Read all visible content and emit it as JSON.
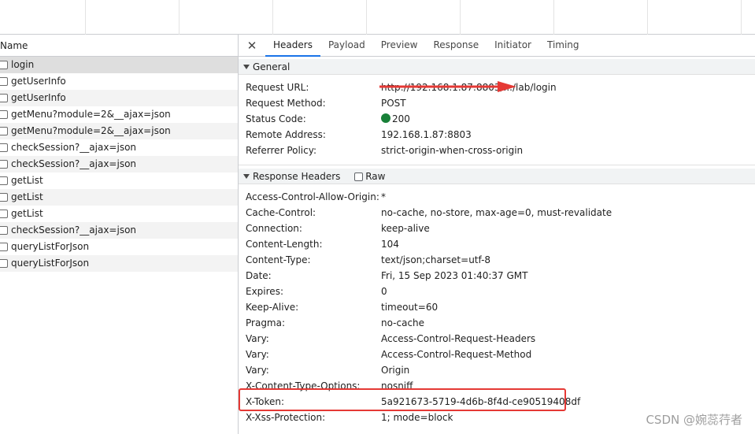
{
  "list": {
    "column_name": "Name",
    "requests": [
      "login",
      "getUserInfo",
      "getUserInfo",
      "getMenu?module=2&__ajax=json",
      "getMenu?module=2&__ajax=json",
      "checkSession?__ajax=json",
      "checkSession?__ajax=json",
      "getList",
      "getList",
      "getList",
      "checkSession?__ajax=json",
      "queryListForJson",
      "queryListForJson"
    ]
  },
  "tabs": {
    "close": "✕",
    "headers": "Headers",
    "payload": "Payload",
    "preview": "Preview",
    "response": "Response",
    "initiator": "Initiator",
    "timing": "Timing"
  },
  "general": {
    "title": "General",
    "request_url_label": "Request URL:",
    "request_url_value": "http://192.168.1.87:8803/.../lab/login",
    "request_method_label": "Request Method:",
    "request_method_value": "POST",
    "status_code_label": "Status Code:",
    "status_code_value": "200",
    "remote_address_label": "Remote Address:",
    "remote_address_value": "192.168.1.87:8803",
    "referrer_policy_label": "Referrer Policy:",
    "referrer_policy_value": "strict-origin-when-cross-origin"
  },
  "response_headers": {
    "title": "Response Headers",
    "raw_label": "Raw",
    "rows": [
      {
        "k": "Access-Control-Allow-Origin:",
        "v": "*"
      },
      {
        "k": "Cache-Control:",
        "v": "no-cache, no-store, max-age=0, must-revalidate"
      },
      {
        "k": "Connection:",
        "v": "keep-alive"
      },
      {
        "k": "Content-Length:",
        "v": "104"
      },
      {
        "k": "Content-Type:",
        "v": "text/json;charset=utf-8"
      },
      {
        "k": "Date:",
        "v": "Fri, 15 Sep 2023 01:40:37 GMT"
      },
      {
        "k": "Expires:",
        "v": "0"
      },
      {
        "k": "Keep-Alive:",
        "v": "timeout=60"
      },
      {
        "k": "Pragma:",
        "v": "no-cache"
      },
      {
        "k": "Vary:",
        "v": "Access-Control-Request-Headers"
      },
      {
        "k": "Vary:",
        "v": "Access-Control-Request-Method"
      },
      {
        "k": "Vary:",
        "v": "Origin"
      },
      {
        "k": "X-Content-Type-Options:",
        "v": "nosniff"
      },
      {
        "k": "X-Token:",
        "v": "5a921673-5719-4d6b-8f4d-ce90519408df"
      },
      {
        "k": "X-Xss-Protection:",
        "v": "1; mode=block"
      }
    ]
  },
  "colors": {
    "status_ok": "#188038",
    "annotation_red": "#e53935",
    "active_tab_underline": "#1a73e8"
  },
  "watermark": "CSDN @婉蕊荇者"
}
